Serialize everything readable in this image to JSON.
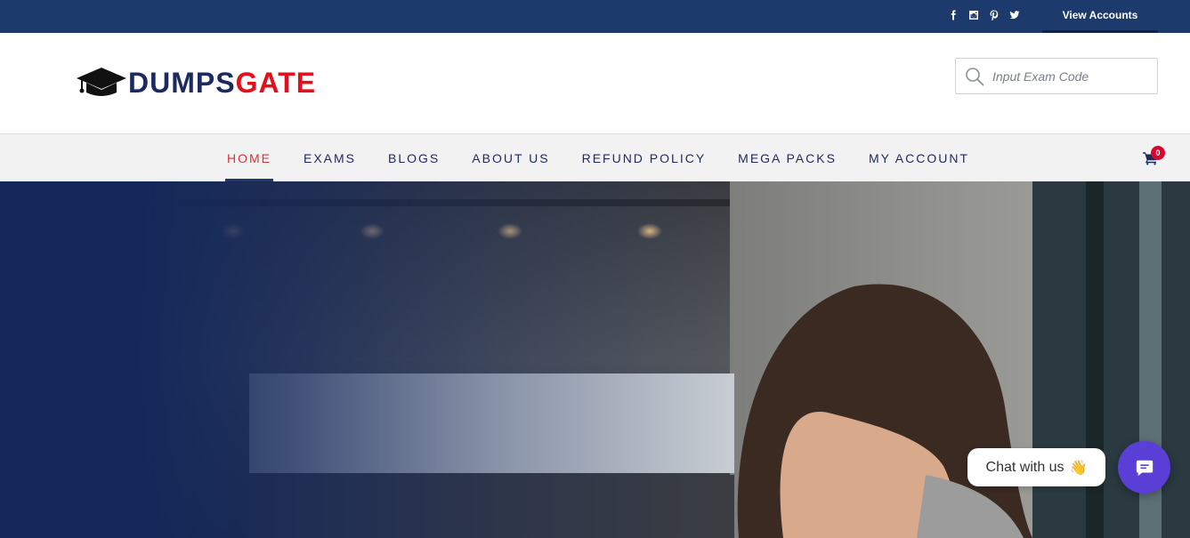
{
  "topbar": {
    "social": [
      "facebook-icon",
      "instagram-icon",
      "pinterest-icon",
      "twitter-icon"
    ],
    "view_accounts": "View Accounts"
  },
  "header": {
    "logo_part1": "DUMPS",
    "logo_part2": "GATE",
    "search_placeholder": "Input Exam Code"
  },
  "nav": {
    "items": [
      {
        "label": "HOME",
        "active": true
      },
      {
        "label": "EXAMS"
      },
      {
        "label": "BLOGS"
      },
      {
        "label": "ABOUT US"
      },
      {
        "label": "REFUND POLICY"
      },
      {
        "label": "MEGA PACKS"
      },
      {
        "label": "MY ACCOUNT"
      }
    ],
    "cart_count": "0"
  },
  "chat": {
    "label": "Chat with us",
    "emoji": "👋"
  },
  "colors": {
    "topbar": "#1c3a6b",
    "brand_navy": "#1c2a5e",
    "brand_red": "#e3101c",
    "active_nav": "#d9323a",
    "chat_button": "#5a3fd6"
  }
}
